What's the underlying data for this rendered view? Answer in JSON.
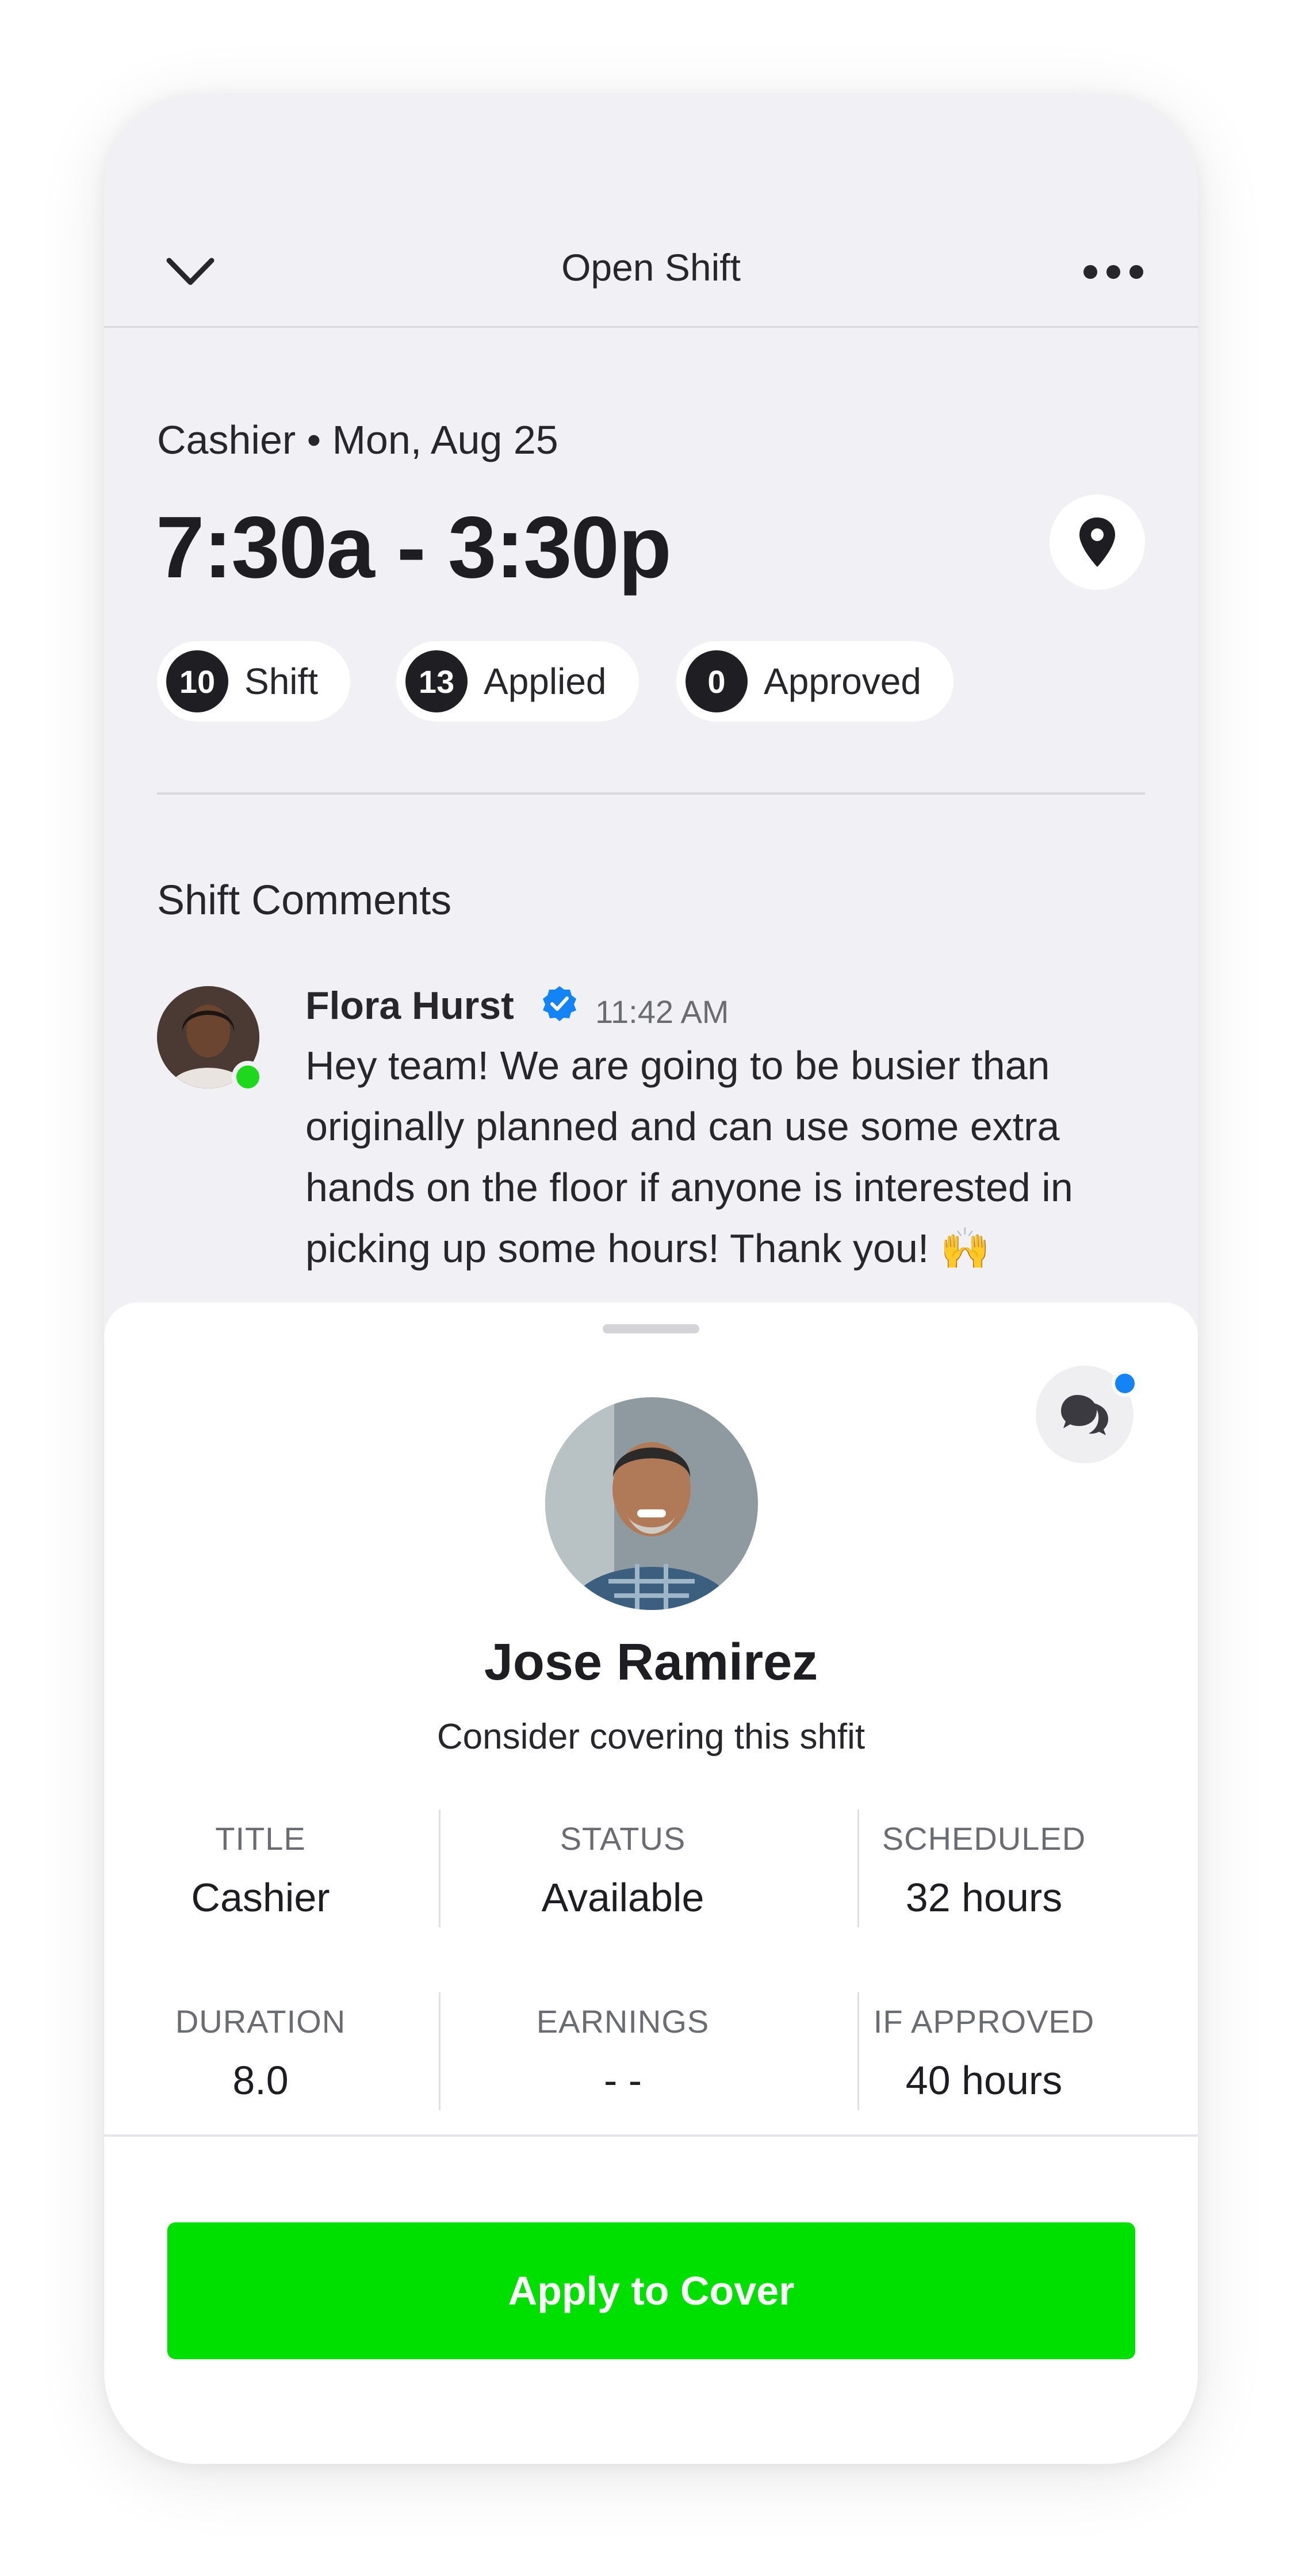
{
  "header": {
    "title": "Open Shift",
    "back_icon": "chevron-down-icon",
    "more_icon": "more-horizontal-icon"
  },
  "shift": {
    "role_date": "Cashier • Mon, Aug 25",
    "time": "7:30a - 3:30p",
    "location_icon": "map-pin-icon",
    "pills": [
      {
        "count": "10",
        "label": "Shift"
      },
      {
        "count": "13",
        "label": "Applied"
      },
      {
        "count": "0",
        "label": "Approved"
      }
    ]
  },
  "comments": {
    "title": "Shift Comments",
    "items": [
      {
        "author": "Flora Hurst",
        "verified": true,
        "time": "11:42 AM",
        "text": "Hey team! We are going to be busier than originally planned and can use some extra hands on the floor if anyone is interested in picking up some hours! Thank you! 🙌",
        "online": true
      }
    ]
  },
  "sheet": {
    "chat_icon": "chat-bubbles-icon",
    "has_notification": true,
    "name": "Jose Ramirez",
    "subtitle": "Consider covering this shfit",
    "stats": [
      {
        "label": "TITLE",
        "value": "Cashier"
      },
      {
        "label": "STATUS",
        "value": "Available"
      },
      {
        "label": "SCHEDULED",
        "value": "32 hours"
      },
      {
        "label": "DURATION",
        "value": "8.0"
      },
      {
        "label": "EARNINGS",
        "value": "- -"
      },
      {
        "label": "IF APPROVED",
        "value": "40 hours"
      }
    ],
    "button_label": "Apply to Cover"
  },
  "colors": {
    "accent_green": "#00e000",
    "online_green": "#1ed81e",
    "verified_blue": "#1483f5",
    "background": "#f1f1f5"
  }
}
